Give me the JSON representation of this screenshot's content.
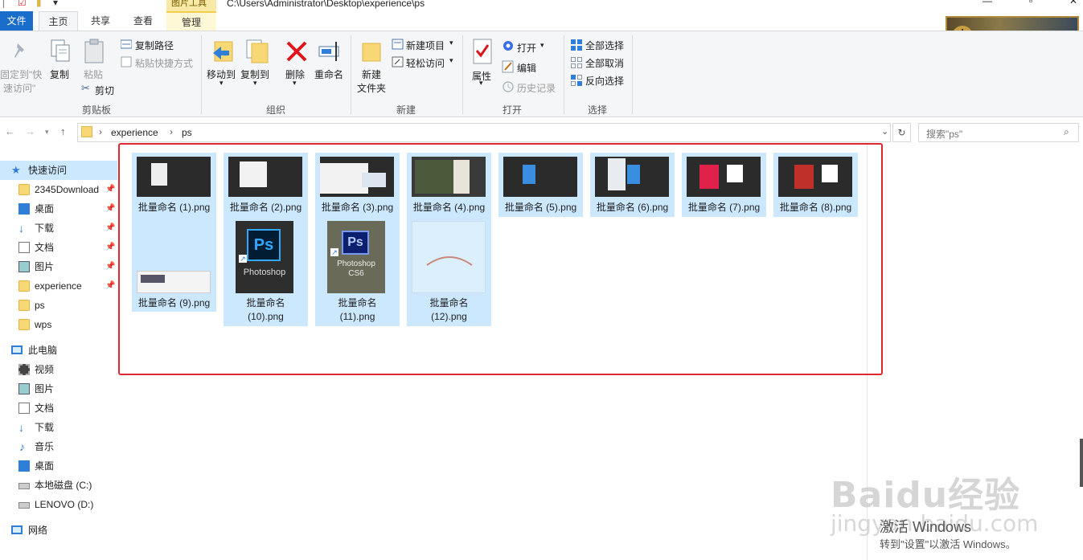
{
  "window": {
    "title_path": "C:\\Users\\Administrator\\Desktop\\experience\\ps",
    "context_tab_header": "图片工具"
  },
  "tabs": {
    "file": "文件",
    "home": "主页",
    "share": "共享",
    "view": "查看",
    "manage": "管理"
  },
  "ribbon": {
    "clipboard": {
      "pin_quick_access": [
        "固定到\"快",
        "速访问\""
      ],
      "copy": "复制",
      "paste": "粘贴",
      "copy_path": "复制路径",
      "paste_shortcut": "粘贴快捷方式",
      "cut": "剪切",
      "group": "剪贴板"
    },
    "organize": {
      "move_to": "移动到",
      "copy_to": "复制到",
      "delete": "删除",
      "rename": "重命名",
      "group": "组织"
    },
    "new": {
      "new_folder": [
        "新建",
        "文件夹"
      ],
      "new_item": "新建项目",
      "easy_access": "轻松访问",
      "group": "新建"
    },
    "open": {
      "properties": "属性",
      "open": "打开",
      "edit": "编辑",
      "history": "历史记录",
      "group": "打开"
    },
    "select": {
      "select_all": "全部选择",
      "select_none": "全部取消",
      "invert": "反向选择",
      "group": "选择"
    }
  },
  "address": {
    "crumbs": [
      "experience",
      "ps"
    ],
    "search_placeholder": "搜索\"ps\""
  },
  "nav": {
    "quick_access": "快速访问",
    "pinned": [
      "2345Download",
      "桌面",
      "下载",
      "文档",
      "图片",
      "experience",
      "ps",
      "wps"
    ],
    "this_pc": "此电脑",
    "pc_items": [
      "视频",
      "图片",
      "文档",
      "下载",
      "音乐",
      "桌面",
      "本地磁盘 (C:)",
      "LENOVO (D:)"
    ],
    "network": "网络"
  },
  "files": [
    "批量命名 (1).png",
    "批量命名 (2).png",
    "批量命名 (3).png",
    "批量命名 (4).png",
    "批量命名 (5).png",
    "批量命名 (6).png",
    "批量命名 (7).png",
    "批量命名 (8).png",
    "批量命名 (9).png",
    [
      "批量命名",
      "(10).png"
    ],
    [
      "批量命名",
      "(11).png"
    ],
    [
      "批量命名",
      "(12).png"
    ]
  ],
  "thumb_text": {
    "ps10": "Photoshop",
    "ps11_line1": "Photoshop",
    "ps11_line2": "CS6",
    "ps_logo": "Ps"
  },
  "watermark": {
    "brand": "Baidu经验",
    "url": "jingyan.baidu.com"
  },
  "activation": {
    "line1": "激活 Windows",
    "line2": "转到\"设置\"以激活 Windows。"
  },
  "colors": {
    "accent": "#1a6ecb",
    "selection": "#cce8ff",
    "highlight_box": "#e0272f"
  }
}
